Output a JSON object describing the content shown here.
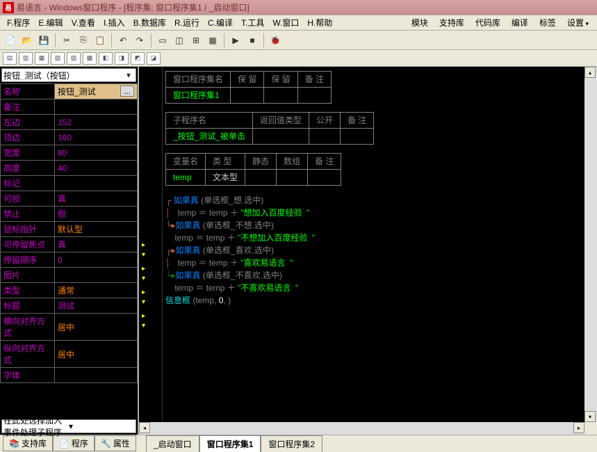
{
  "title": "易语言 - Windows窗口程序 - [程序集: 窗口程序集1 / _启动窗口]",
  "menu": {
    "file": "F.程序",
    "edit": "E.编辑",
    "view": "V.查看",
    "insert": "I.插入",
    "db": "B.数据库",
    "run": "R.运行",
    "compile": "C.编译",
    "tool": "T.工具",
    "window": "W.窗口",
    "help": "H.帮助"
  },
  "rmenu": {
    "module": "模块",
    "support": "支持库",
    "codelib": "代码库",
    "compile": "编译",
    "label": "标签",
    "settings": "设置"
  },
  "left_combo": "按钮_测试（按钮）",
  "props": [
    {
      "k": "名称",
      "v": "按钮_测试",
      "cls": "v-orange sel",
      "dots": true
    },
    {
      "k": "备注",
      "v": "",
      "cls": "v-white"
    },
    {
      "k": "左边",
      "v": "152",
      "cls": "v-magenta"
    },
    {
      "k": "顶边",
      "v": "160",
      "cls": "v-magenta"
    },
    {
      "k": "宽度",
      "v": "80",
      "cls": "v-magenta"
    },
    {
      "k": "高度",
      "v": "40",
      "cls": "v-magenta"
    },
    {
      "k": "标记",
      "v": "",
      "cls": "v-white"
    },
    {
      "k": "可视",
      "v": "真",
      "cls": "v-magenta"
    },
    {
      "k": "禁止",
      "v": "假",
      "cls": "v-magenta"
    },
    {
      "k": "鼠标指针",
      "v": "默认型",
      "cls": "v-orange"
    },
    {
      "k": "可停留焦点",
      "v": "真",
      "cls": "v-magenta"
    },
    {
      "k": "  停留顺序",
      "v": "0",
      "cls": "v-magenta"
    },
    {
      "k": "图片",
      "v": "",
      "cls": "v-white"
    },
    {
      "k": "类型",
      "v": "通常",
      "cls": "v-orange"
    },
    {
      "k": "标题",
      "v": "测试",
      "cls": "v-magenta"
    },
    {
      "k": "横向对齐方式",
      "v": "居中",
      "cls": "v-orange"
    },
    {
      "k": "纵向对齐方式",
      "v": "居中",
      "cls": "v-orange"
    },
    {
      "k": "字体",
      "v": "",
      "cls": "v-white"
    }
  ],
  "event_combo": "在此处选择加入事件处理子程序",
  "btabs": {
    "support": "支持库",
    "program": "程序",
    "property": "属性"
  },
  "doctabs": {
    "t1": "_启动窗口",
    "t2": "窗口程序集1",
    "t3": "窗口程序集2"
  },
  "tables": {
    "t1": {
      "h1": "窗口程序集名",
      "h2": "保  留",
      "h3": "保  留",
      "h4": "备  注",
      "v1": "窗口程序集1"
    },
    "t2": {
      "h1": "子程序名",
      "h2": "返回值类型",
      "h3": "公开",
      "h4": "备  注",
      "v1": "_按钮_测试_被单击"
    },
    "t3": {
      "h1": "变量名",
      "h2": "类  型",
      "h3": "静态",
      "h4": "数组",
      "h5": "备  注",
      "v1": "temp",
      "v2": "文本型"
    }
  },
  "code": {
    "if": "如果真",
    "rb1": "单选框_想",
    "rb2": "单选框_不想",
    "rb3": "单选框_喜欢",
    "rb4": "单选框_不喜欢",
    "sel": "选中",
    "temp": "temp",
    "plus": "＋",
    "eq": "＝",
    "s1": "\"想加入百度经验  \"",
    "s2": "\"不想加入百度经验  \"",
    "s3": "\"喜欢易语言  \"",
    "s4": "\"不喜欢易语言  \"",
    "msgbox": "信息框",
    "zero": "0",
    "comma": ", "
  }
}
